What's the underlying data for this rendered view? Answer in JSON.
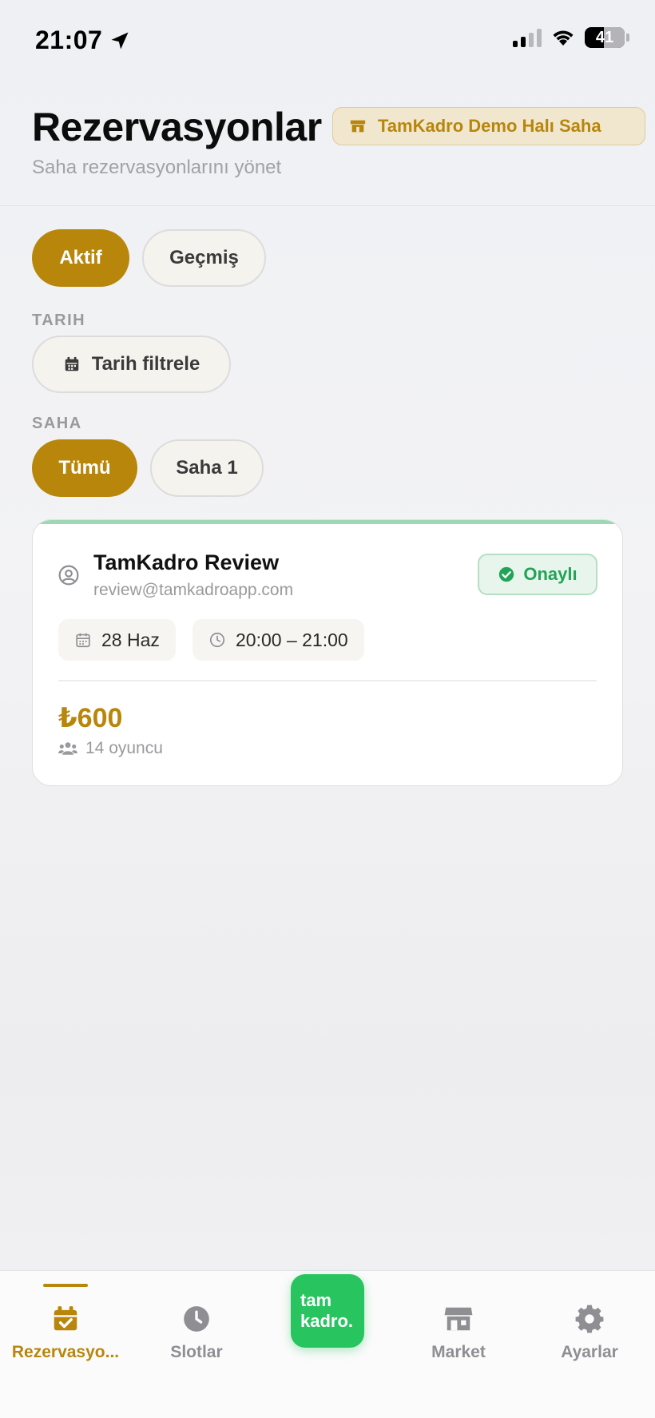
{
  "status_bar": {
    "time": "21:07",
    "battery": "41"
  },
  "header": {
    "title": "Rezervasyonlar",
    "subtitle": "Saha rezervasyonlarını yönet",
    "venue_badge": "TamKadro Demo Halı Saha"
  },
  "filters": {
    "tabs": [
      {
        "label": "Aktif",
        "active": true
      },
      {
        "label": "Geçmiş",
        "active": false
      }
    ],
    "date_label": "TARIH",
    "date_filter_button": "Tarih filtrele",
    "field_label": "SAHA",
    "field_options": [
      {
        "label": "Tümü",
        "active": true
      },
      {
        "label": "Saha 1",
        "active": false
      }
    ]
  },
  "reservations": [
    {
      "customer_name": "TamKadro Review",
      "customer_email": "review@tamkadroapp.com",
      "status": "Onaylı",
      "date": "28 Haz",
      "time_range": "20:00 – 21:00",
      "price": "₺600",
      "players": "14 oyuncu"
    }
  ],
  "tab_bar": {
    "items": [
      {
        "label": "Rezervasyo...",
        "icon": "calendar-check-icon",
        "active": true
      },
      {
        "label": "Slotlar",
        "icon": "clock-icon",
        "active": false
      },
      {
        "label": "Market",
        "icon": "store-icon",
        "active": false
      },
      {
        "label": "Ayarlar",
        "icon": "gear-icon",
        "active": false
      }
    ],
    "logo_line1": "tam",
    "logo_line2": "kadro."
  },
  "colors": {
    "accent": "#b8860b",
    "success": "#22a355",
    "logo_green": "#27c45f"
  }
}
